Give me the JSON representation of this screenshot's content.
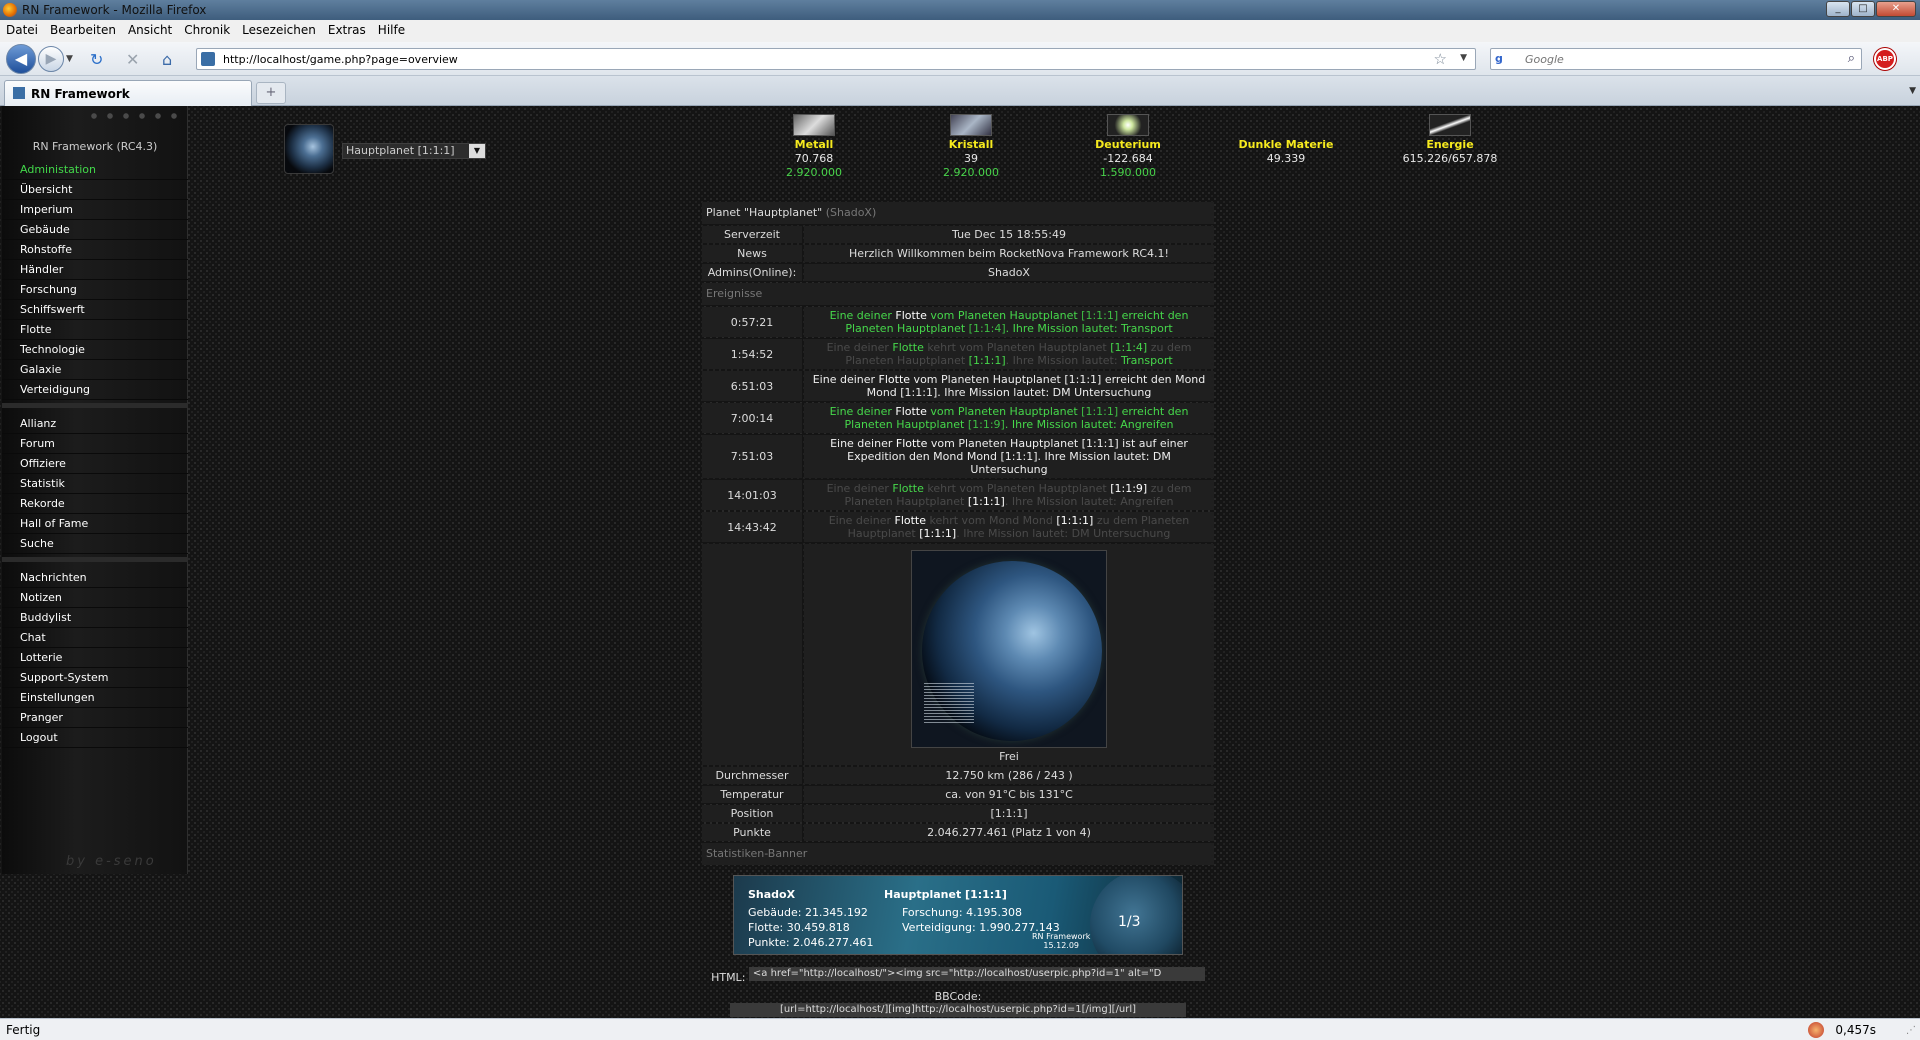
{
  "window": {
    "title": "RN Framework - Mozilla Firefox"
  },
  "menubar": [
    "Datei",
    "Bearbeiten",
    "Ansicht",
    "Chronik",
    "Lesezeichen",
    "Extras",
    "Hilfe"
  ],
  "nav": {
    "url": "http://localhost/game.php?page=overview",
    "search_placeholder": "Google"
  },
  "tab": {
    "title": "RN Framework"
  },
  "leftmenu": {
    "server": "RN Framework (RC4.3)",
    "admin": "Administation",
    "group1": [
      "Übersicht",
      "Imperium",
      "Gebäude",
      "Rohstoffe",
      "Händler",
      "Forschung",
      "Schiffswerft",
      "Flotte",
      "Technologie",
      "Galaxie",
      "Verteidigung"
    ],
    "group2": [
      "Allianz",
      "Forum",
      "Offiziere",
      "Statistik",
      "Rekorde",
      "Hall of Fame",
      "Suche"
    ],
    "group3": [
      "Nachrichten",
      "Notizen",
      "Buddylist",
      "Chat",
      "Lotterie",
      "Support-System",
      "Einstellungen",
      "Pranger",
      "Logout"
    ],
    "brand": "by e-seno"
  },
  "planet_select": "Hauptplanet [1:1:1]",
  "resources": [
    {
      "name": "Metall",
      "amount": "70.768",
      "max": "2.920.000"
    },
    {
      "name": "Kristall",
      "amount": "39",
      "max": "2.920.000"
    },
    {
      "name": "Deuterium",
      "amount": "-122.684",
      "max": "1.590.000"
    },
    {
      "name": "Dunkle Materie",
      "amount": "49.339",
      "max": ""
    },
    {
      "name": "Energie",
      "amount": "615.226/657.878",
      "max": ""
    }
  ],
  "overview": {
    "title": "Planet \"Hauptplanet\"",
    "title_user": "(ShadoX)",
    "rows": [
      {
        "label": "Serverzeit",
        "value": "Tue Dec 15 18:55:49"
      },
      {
        "label": "News",
        "value": "Herzlich Willkommen beim RocketNova Framework RC4.1!"
      },
      {
        "label": "Admins(Online):",
        "value": "ShadoX"
      }
    ],
    "events_header": "Ereignisse",
    "events": [
      {
        "time": "0:57:21",
        "p1": "Eine deiner ",
        "b1": "Flotte",
        "p2": " vom Planeten Hauptplanet ",
        "b2": "[1:1:1]",
        "p3": " erreicht den Planeten Hauptplanet ",
        "b3": "[1:1:4]",
        "p4": ". Ihre Mission lautet: ",
        "b4": "Transport"
      },
      {
        "time": "1:54:52",
        "p1": "Eine deiner ",
        "b1": "Flotte",
        "p2": " kehrt vom Planeten Hauptplanet ",
        "b2": "[1:1:4]",
        "p3": " zu dem Planeten Hauptplanet ",
        "b3": "[1:1:1]",
        "p4": ". Ihre Mission lautet: ",
        "b4": "Transport"
      },
      {
        "time": "6:51:03",
        "p1": "Eine deiner ",
        "b1": "Flotte",
        "p2": " vom Planeten Hauptplanet ",
        "b2": "[1:1:1]",
        "p3": " erreicht den Mond Mond ",
        "b3": "[1:1:1]",
        "p4": ". Ihre Mission lautet: ",
        "b4": "DM Untersuchung"
      },
      {
        "time": "7:00:14",
        "p1": "Eine deiner ",
        "b1": "Flotte",
        "p2": " vom Planeten Hauptplanet ",
        "b2": "[1:1:1]",
        "p3": " erreicht den Planeten Hauptplanet ",
        "b3": "[1:1:9]",
        "p4": ". Ihre Mission lautet: ",
        "b4": "Angreifen"
      },
      {
        "time": "7:51:03",
        "p1": "Eine deiner ",
        "b1": "Flotte",
        "p2": " vom Planeten Hauptplanet ",
        "b2": "[1:1:1]",
        "p3": " ist auf einer Expedition den Mond Mond ",
        "b3": "[1:1:1]",
        "p4": ". Ihre Mission lautet: ",
        "b4": "DM Untersuchung"
      },
      {
        "time": "14:01:03",
        "p1": "Eine deiner ",
        "b1": "Flotte",
        "p2": " kehrt vom Planeten Hauptplanet ",
        "b2": "[1:1:9]",
        "p3": " zu dem Planeten Hauptplanet ",
        "b3": "[1:1:1]",
        "p4": ". Ihre Mission lautet: ",
        "b4": "Angreifen"
      },
      {
        "time": "14:43:42",
        "p1": "Eine deiner ",
        "b1": "Flotte",
        "p2": " kehrt vom Mond Mond ",
        "b2": "[1:1:1]",
        "p3": " zu dem Planeten Hauptplanet ",
        "b3": "[1:1:1]",
        "p4": ". Ihre Mission lautet: ",
        "b4": "DM Untersuchung"
      }
    ],
    "planet_status": "Frei",
    "details": [
      {
        "label": "Durchmesser",
        "value": "12.750 km (286 / 243 )"
      },
      {
        "label": "Temperatur",
        "value": "ca. von 91°C bis 131°C"
      },
      {
        "label": "Position",
        "value": "[1:1:1]"
      },
      {
        "label": "Punkte",
        "value": "2.046.277.461 (Platz 1 von 4)"
      }
    ],
    "banner_header": "Statistiken-Banner",
    "banner": {
      "user": "ShadoX",
      "planet": "Hauptplanet [1:1:1]",
      "l1": "Gebäude: 21.345.192",
      "l2": "Flotte: 30.459.818",
      "l3": "Punkte: 2.046.277.461",
      "r1": "Forschung: 4.195.308",
      "r2": "Verteidigung: 1.990.277.143",
      "rank": "1/3",
      "brand": "RN Framework",
      "date": "15.12.09"
    },
    "html_label": "HTML:",
    "html_code": "<a href=\"http://localhost/\"><img src=\"http://localhost/userpic.php?id=1\" alt=\"D",
    "bb_label": "BBCode:",
    "bb_code": "[url=http://localhost/][img]http://localhost/userpic.php?id=1[/img][/url]"
  },
  "status": {
    "text": "Fertig",
    "timer": "0,457s"
  }
}
